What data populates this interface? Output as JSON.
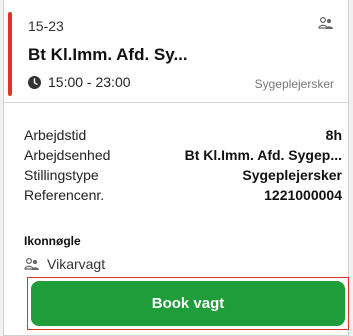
{
  "shift": {
    "date": "15-23",
    "title": "Bt Kl.Imm. Afd. Sy...",
    "time": "15:00 - 23:00",
    "role": "Sygeplejersker"
  },
  "details": [
    {
      "label": "Arbejdstid",
      "value": "8h"
    },
    {
      "label": "Arbejdsenhed",
      "value": "Bt Kl.Imm. Afd. Sygep..."
    },
    {
      "label": "Stillingstype",
      "value": "Sygeplejersker"
    },
    {
      "label": "Referencenr.",
      "value": "1221000004"
    }
  ],
  "icon_legend": {
    "title": "Ikonnøgle",
    "items": [
      {
        "icon": "substitute-people-icon",
        "label": "Vikarvagt"
      }
    ]
  },
  "actions": {
    "book_label": "Book vagt"
  },
  "colors": {
    "accent": "#e0342b",
    "primary": "#1f9d3a"
  }
}
